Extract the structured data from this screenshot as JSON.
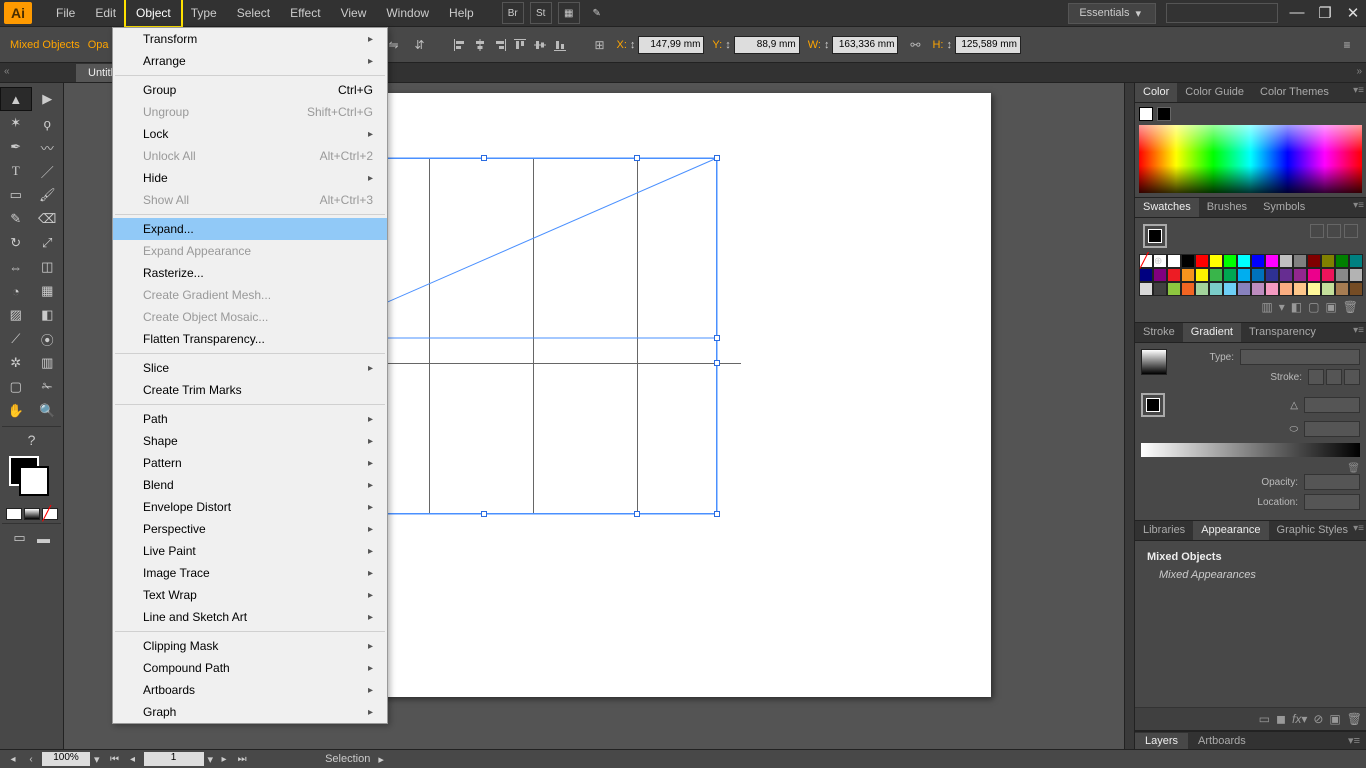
{
  "app": {
    "icon_text": "Ai"
  },
  "menubar": {
    "items": [
      "File",
      "Edit",
      "Object",
      "Type",
      "Select",
      "Effect",
      "View",
      "Window",
      "Help"
    ],
    "highlighted_index": 2,
    "bridge": "Br",
    "stock": "St",
    "workspace": "Essentials"
  },
  "window_controls": {
    "min": "—",
    "max": "❐",
    "close": "✕"
  },
  "controlbar": {
    "selection_label": "Mixed Objects",
    "opacity_label": "Opa",
    "x_label": "X:",
    "x_value": "147,99 mm",
    "y_label": "Y:",
    "y_value": "88,9 mm",
    "w_label": "W:",
    "w_value": "163,336 mm",
    "h_label": "H:",
    "h_value": "125,589 mm"
  },
  "doctab": {
    "title": "Untitl"
  },
  "dropdown": {
    "groups": [
      [
        {
          "label": "Transform",
          "submenu": true
        },
        {
          "label": "Arrange",
          "submenu": true
        }
      ],
      [
        {
          "label": "Group",
          "shortcut": "Ctrl+G"
        },
        {
          "label": "Ungroup",
          "shortcut": "Shift+Ctrl+G",
          "disabled": true
        },
        {
          "label": "Lock",
          "submenu": true
        },
        {
          "label": "Unlock All",
          "shortcut": "Alt+Ctrl+2",
          "disabled": true
        },
        {
          "label": "Hide",
          "submenu": true
        },
        {
          "label": "Show All",
          "shortcut": "Alt+Ctrl+3",
          "disabled": true
        }
      ],
      [
        {
          "label": "Expand...",
          "selected": true
        },
        {
          "label": "Expand Appearance",
          "disabled": true
        },
        {
          "label": "Rasterize..."
        },
        {
          "label": "Create Gradient Mesh...",
          "disabled": true
        },
        {
          "label": "Create Object Mosaic...",
          "disabled": true
        },
        {
          "label": "Flatten Transparency..."
        }
      ],
      [
        {
          "label": "Slice",
          "submenu": true
        },
        {
          "label": "Create Trim Marks"
        }
      ],
      [
        {
          "label": "Path",
          "submenu": true
        },
        {
          "label": "Shape",
          "submenu": true
        },
        {
          "label": "Pattern",
          "submenu": true
        },
        {
          "label": "Blend",
          "submenu": true
        },
        {
          "label": "Envelope Distort",
          "submenu": true
        },
        {
          "label": "Perspective",
          "submenu": true
        },
        {
          "label": "Live Paint",
          "submenu": true
        },
        {
          "label": "Image Trace",
          "submenu": true
        },
        {
          "label": "Text Wrap",
          "submenu": true
        },
        {
          "label": "Line and Sketch Art",
          "submenu": true
        }
      ],
      [
        {
          "label": "Clipping Mask",
          "submenu": true
        },
        {
          "label": "Compound Path",
          "submenu": true
        },
        {
          "label": "Artboards",
          "submenu": true
        },
        {
          "label": "Graph",
          "submenu": true
        }
      ]
    ]
  },
  "right": {
    "color_tabs": [
      "Color",
      "Color Guide",
      "Color Themes"
    ],
    "swatch_tabs": [
      "Swatches",
      "Brushes",
      "Symbols"
    ],
    "stroke_tabs": [
      "Stroke",
      "Gradient",
      "Transparency"
    ],
    "gradient": {
      "type_label": "Type:",
      "stroke_label": "Stroke:",
      "angle_label": "",
      "opacity_label": "Opacity:",
      "location_label": "Location:"
    },
    "appearance_tabs": [
      "Libraries",
      "Appearance",
      "Graphic Styles"
    ],
    "appearance": {
      "title": "Mixed Objects",
      "sub": "Mixed Appearances"
    },
    "bottom_tabs": [
      "Layers",
      "Artboards"
    ]
  },
  "swatch_colors": [
    "#ffffff",
    "#000000",
    "#ff0000",
    "#ffff00",
    "#00ff00",
    "#00ffff",
    "#0000ff",
    "#ff00ff",
    "#c0c0c0",
    "#808080",
    "#800000",
    "#808000",
    "#008000",
    "#008080",
    "#000080",
    "#800080",
    "#ed1c24",
    "#f7941d",
    "#fff200",
    "#39b54a",
    "#00a651",
    "#00aeef",
    "#0072bc",
    "#2e3192",
    "#662d91",
    "#92278f",
    "#ec008c",
    "#ed145b",
    "#898989",
    "#b3b3b3",
    "#d9d9d9",
    "#404040",
    "#8dc63f",
    "#f26522",
    "#a3d39c",
    "#7accc8",
    "#6dcff6",
    "#8781bd",
    "#bd8cbf",
    "#f49ac1",
    "#f9ad81",
    "#fdc68a",
    "#fff799",
    "#c4df9b",
    "#a67c52",
    "#754c24",
    "#603913",
    "#42210b"
  ],
  "status": {
    "zoom": "100%",
    "artboard_nav": "1",
    "tool": "Selection"
  },
  "arrow": "▸",
  "dropdown_caret": "▾"
}
